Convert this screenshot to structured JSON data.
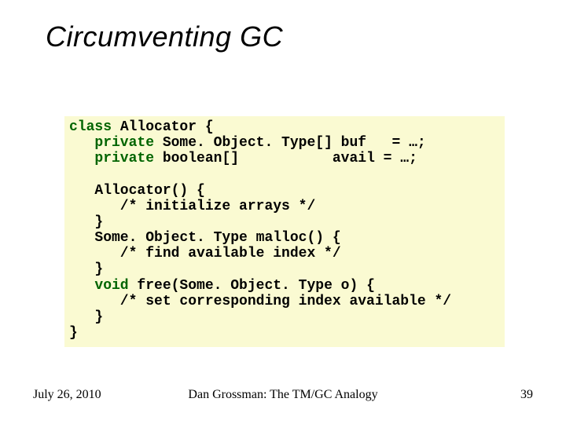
{
  "title": "Circumventing GC",
  "code": {
    "l1a": "class",
    "l1b": " Allocator {",
    "l2a": "   private",
    "l2b": " Some. Object. Type[] buf   = …;",
    "l3a": "   private",
    "l3b": " boolean[]           avail = …;",
    "blank1": "",
    "l4": "   Allocator() {",
    "l5": "      /* initialize arrays */",
    "l6": "   }",
    "l7": "   Some. Object. Type malloc() {  ",
    "l8": "      /* find available index */",
    "l9": "   }",
    "l10a": "   void",
    "l10b": " free(Some. Object. Type o) {",
    "l11": "      /* set corresponding index available */",
    "l12": "   }",
    "l13": "}"
  },
  "footer": {
    "date": "July 26, 2010",
    "center": "Dan Grossman: The TM/GC Analogy",
    "page": "39"
  }
}
